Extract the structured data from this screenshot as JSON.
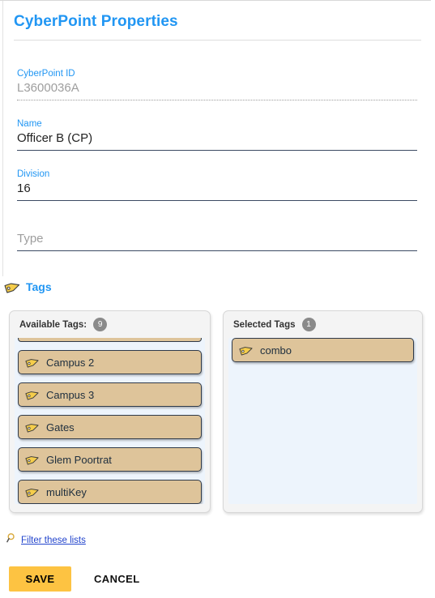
{
  "header": {
    "title": "CyberPoint Properties"
  },
  "form": {
    "fields": [
      {
        "label": "CyberPoint ID",
        "value": "L3600036A",
        "placeholder": "",
        "state": "disabled",
        "underline": "dotted"
      },
      {
        "label": "Name",
        "value": "Officer B (CP)",
        "placeholder": "",
        "state": "editable",
        "underline": "solid"
      },
      {
        "label": "Division",
        "value": "16",
        "placeholder": "",
        "state": "editable",
        "underline": "solid"
      },
      {
        "label": "",
        "value": "",
        "placeholder": "Type",
        "state": "empty",
        "underline": "solid"
      }
    ]
  },
  "tags_section": {
    "heading": "Tags",
    "heading_icon": "tag-icon",
    "available": {
      "label": "Available Tags:",
      "count": "9",
      "items": [
        {
          "label": "",
          "clipped": true
        },
        {
          "label": "Campus 2",
          "clipped": false
        },
        {
          "label": "Campus 3",
          "clipped": false
        },
        {
          "label": "Gates",
          "clipped": false
        },
        {
          "label": "Glem Poortrat",
          "clipped": false
        },
        {
          "label": "multiKey",
          "clipped": false
        }
      ]
    },
    "selected": {
      "label": "Selected Tags",
      "count": "1",
      "items": [
        {
          "label": "combo",
          "clipped": false
        }
      ]
    }
  },
  "filter": {
    "icon": "magnifier-icon",
    "label": "Filter these lists"
  },
  "actions": {
    "save_label": "SAVE",
    "cancel_label": "CANCEL"
  },
  "colors": {
    "accent_blue": "#2196f3",
    "tag_fill": "#dec49a",
    "tag_border": "#2f3a4a",
    "tag_icon_yellow": "#f5cd4b",
    "save_amber": "#fdc342",
    "badge_grey": "#8a8a8a",
    "list_bg": "#edf4fc",
    "link_blue": "#2244cc"
  }
}
